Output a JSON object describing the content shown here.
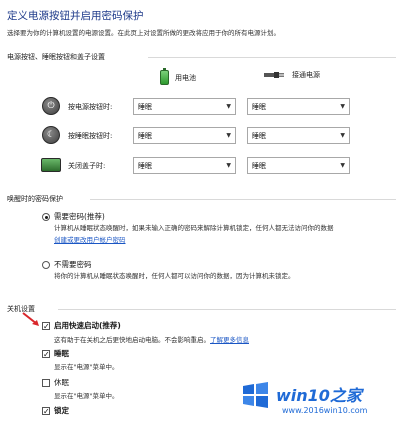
{
  "header": {
    "title": "定义电源按钮并启用密码保护",
    "subtitle": "选择要为你的计算机设置的电源设置。在此页上对设置所做的更改将应用于你的所有电源计划。"
  },
  "power_buttons": {
    "section_label": "电源按钮、睡眠按钮和盖子设置",
    "col_battery": "用电池",
    "col_plugged": "接通电源",
    "rows": [
      {
        "label": "按电源按钮时:",
        "icon": "power-icon",
        "battery": "睡眠",
        "plugged": "睡眠"
      },
      {
        "label": "按睡眠按钮时:",
        "icon": "sleep-icon",
        "battery": "睡眠",
        "plugged": "睡眠"
      },
      {
        "label": "关闭盖子时:",
        "icon": "laptop-lid-icon",
        "battery": "睡眠",
        "plugged": "睡眠"
      }
    ]
  },
  "wake_password": {
    "section_label": "唤醒时的密码保护",
    "require_label": "需要密码(推荐)",
    "require_desc": "计算机从睡眠状态唤醒时，如果未输入正确的密码来解除计算机锁定，任何人都无法访问你的数据",
    "require_link": "创建或更改用户帐户密码",
    "no_require_label": "不需要密码",
    "no_require_desc": "将你的计算机从睡眠状态唤醒时，任何人都可以访问你的数据，因为计算机未锁定。"
  },
  "shutdown": {
    "section_label": "关机设置",
    "fast_startup_label": "启用快速启动(推荐)",
    "fast_startup_desc": "这有助于在关机之后更快地启动电脑。不会影响重启。",
    "fast_startup_link": "了解更多信息",
    "sleep_label": "睡眠",
    "sleep_desc": "显示在\"电源\"菜单中。",
    "hibernate_label": "休眠",
    "hibernate_desc": "显示在\"电源\"菜单中。",
    "lock_label": "锁定"
  },
  "watermark": {
    "brand": "win10之家",
    "url": "www.2016win10.com"
  },
  "colors": {
    "title": "#1e3a8a",
    "link": "#1a56c4",
    "arrow": "#d9262b",
    "watermark": "#1f6ad6"
  }
}
